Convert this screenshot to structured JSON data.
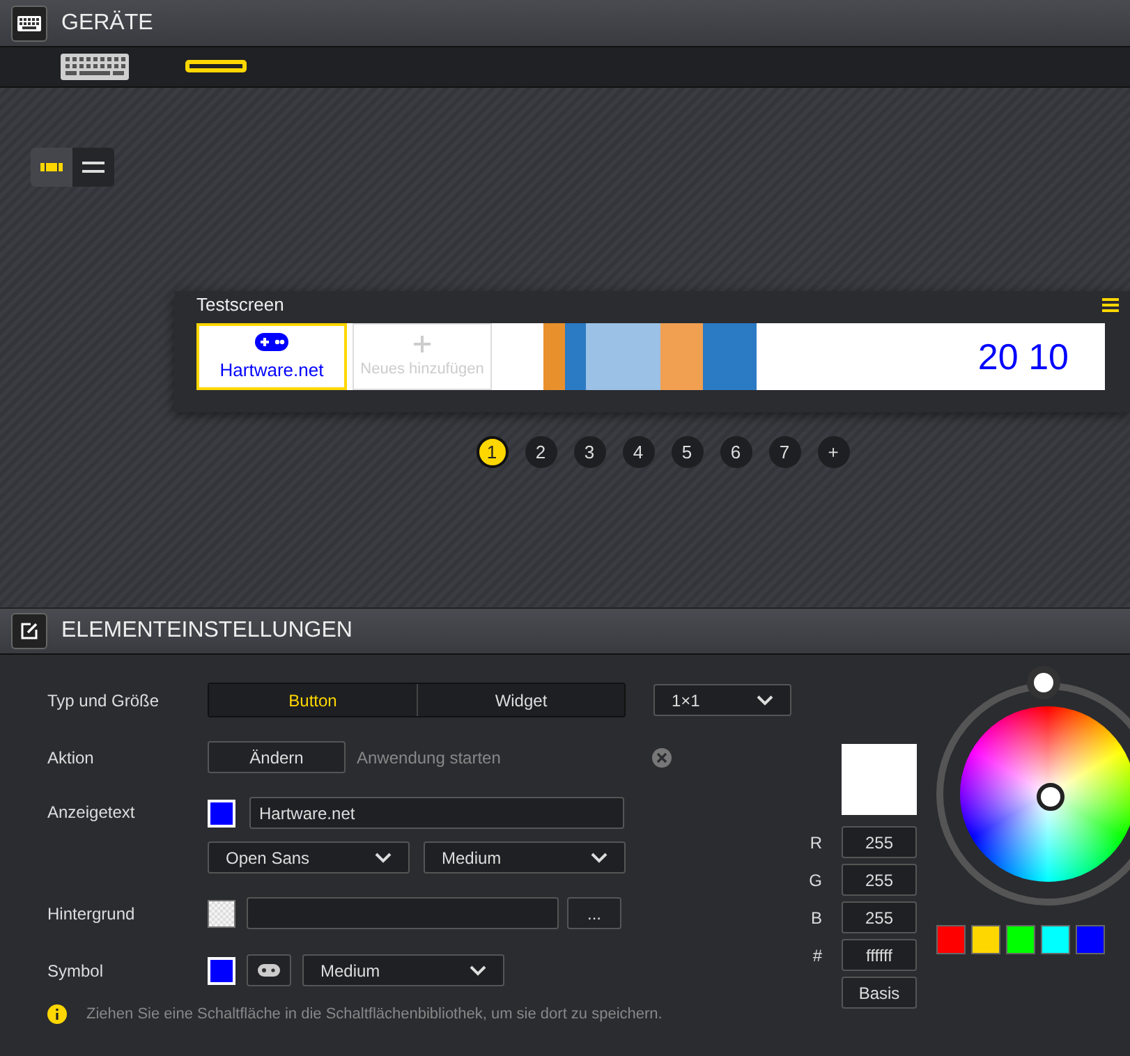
{
  "header": {
    "title": "GERÄTE"
  },
  "devices": [
    {
      "kind": "keyboard",
      "selected": false
    },
    {
      "kind": "bar",
      "selected": true
    }
  ],
  "view_toggle": [
    {
      "kind": "tiles",
      "selected": true
    },
    {
      "kind": "list",
      "selected": false
    }
  ],
  "preview": {
    "title": "Testscreen",
    "clock": "20 10",
    "tiles": [
      {
        "kind": "button",
        "label": "Hartware.net",
        "selected": true
      },
      {
        "kind": "add",
        "label": "Neues hinzufügen",
        "selected": false
      }
    ]
  },
  "pages": [
    {
      "label": "1",
      "selected": true
    },
    {
      "label": "2",
      "selected": false
    },
    {
      "label": "3",
      "selected": false
    },
    {
      "label": "4",
      "selected": false
    },
    {
      "label": "5",
      "selected": false
    },
    {
      "label": "6",
      "selected": false
    },
    {
      "label": "7",
      "selected": false
    },
    {
      "label": "+",
      "selected": false
    }
  ],
  "settings": {
    "title": "ELEMENTEINSTELLUNGEN",
    "type_label": "Typ und Größe",
    "type_options": [
      {
        "label": "Button",
        "selected": true
      },
      {
        "label": "Widget",
        "selected": false
      }
    ],
    "size": "1×1",
    "action_label": "Aktion",
    "action_button": "Ändern",
    "action_value": "Anwendung starten",
    "text_label": "Anzeigetext",
    "text_value": "Hartware.net",
    "font": "Open Sans",
    "font_size": "Medium",
    "background_label": "Hintergrund",
    "background_button": "...",
    "symbol_label": "Symbol",
    "symbol_size": "Medium",
    "hint": "Ziehen Sie eine Schaltfläche in die Schaltflächenbibliothek, um sie dort zu speichern."
  },
  "color_picker": {
    "fields": [
      {
        "label": "R",
        "value": "255"
      },
      {
        "label": "G",
        "value": "255"
      },
      {
        "label": "B",
        "value": "255"
      },
      {
        "label": "#",
        "value": "ffffff"
      }
    ],
    "basis_button": "Basis",
    "swatches": [
      {
        "color": "#ff0000"
      },
      {
        "color": "#ffd700"
      },
      {
        "color": "#00ff00"
      },
      {
        "color": "#00ffff"
      },
      {
        "color": "#0000ff"
      }
    ]
  }
}
